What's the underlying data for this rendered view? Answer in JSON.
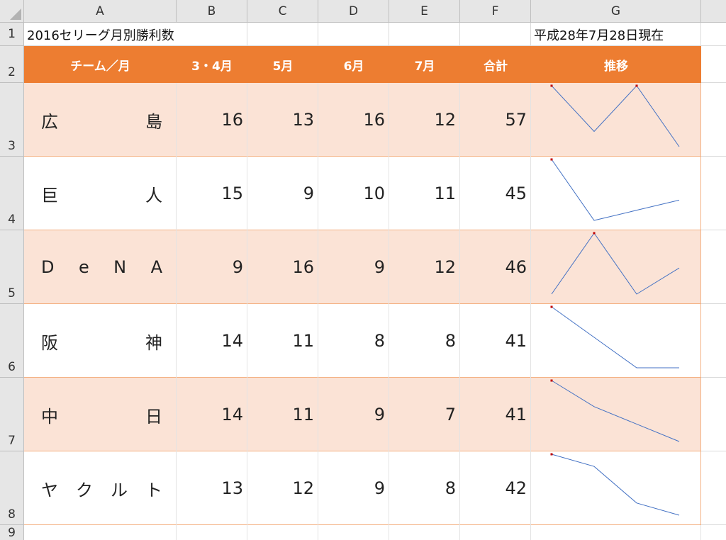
{
  "columns": [
    "A",
    "B",
    "C",
    "D",
    "E",
    "F",
    "G"
  ],
  "rows": [
    "1",
    "2",
    "3",
    "4",
    "5",
    "6",
    "7",
    "8",
    "9"
  ],
  "title": "2016セリーグ月別勝利数",
  "as_of": "平成28年7月28日現在",
  "headers": {
    "team": "チーム／月",
    "m34": "3・4月",
    "m5": "5月",
    "m6": "6月",
    "m7": "7月",
    "total": "合計",
    "trend": "推移"
  },
  "teams": [
    {
      "chars": [
        "広",
        "島"
      ],
      "m34": "16",
      "m5": "13",
      "m6": "16",
      "m7": "12",
      "total": "57"
    },
    {
      "chars": [
        "巨",
        "人"
      ],
      "m34": "15",
      "m5": "9",
      "m6": "10",
      "m7": "11",
      "total": "45"
    },
    {
      "chars": [
        "D",
        "e",
        "N",
        "A"
      ],
      "m34": "9",
      "m5": "16",
      "m6": "9",
      "m7": "12",
      "total": "46"
    },
    {
      "chars": [
        "阪",
        "神"
      ],
      "m34": "14",
      "m5": "11",
      "m6": "8",
      "m7": "8",
      "total": "41"
    },
    {
      "chars": [
        "中",
        "日"
      ],
      "m34": "14",
      "m5": "11",
      "m6": "9",
      "m7": "7",
      "total": "41"
    },
    {
      "chars": [
        "ヤ",
        "ク",
        "ル",
        "ト"
      ],
      "m34": "13",
      "m5": "12",
      "m6": "9",
      "m7": "8",
      "total": "42"
    }
  ],
  "colors": {
    "header_fill": "#ed7d31",
    "band_fill": "#fbe3d6",
    "sparkline": "#4472c4",
    "marker": "#c00000"
  }
}
